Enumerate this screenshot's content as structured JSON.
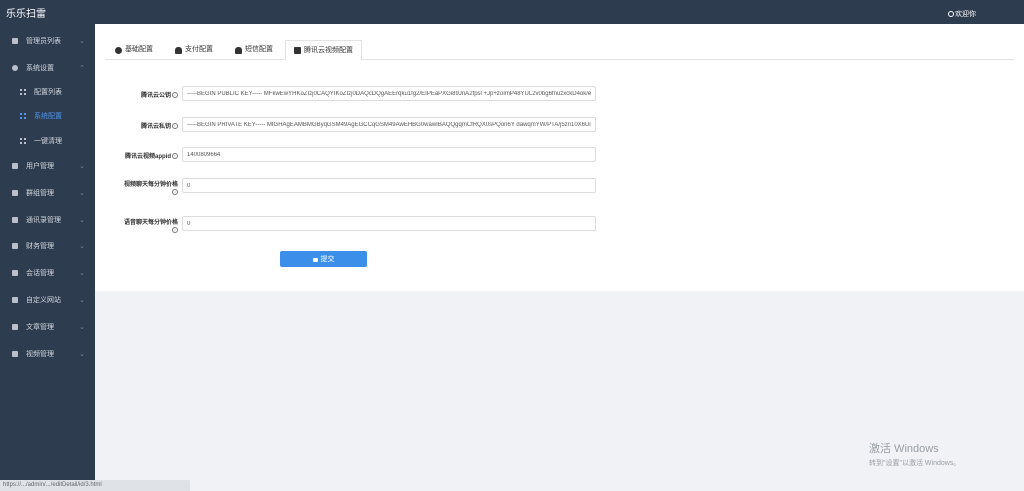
{
  "app": {
    "title": "乐乐扫雷",
    "welcome": "欢迎你"
  },
  "sidebar": {
    "items": [
      {
        "label": "管理员列表",
        "icon": "user-icon"
      },
      {
        "label": "系统设置",
        "icon": "gear-icon"
      },
      {
        "label": "配置列表",
        "icon": "grid-icon"
      },
      {
        "label": "系统配置",
        "icon": "grid-icon"
      },
      {
        "label": "一键清理",
        "icon": "grid-icon"
      },
      {
        "label": "用户管理",
        "icon": "user-icon"
      },
      {
        "label": "群组管理",
        "icon": "group-icon"
      },
      {
        "label": "通讯录管理",
        "icon": "user-icon"
      },
      {
        "label": "财务管理",
        "icon": "chart-icon"
      },
      {
        "label": "会话管理",
        "icon": "chat-icon"
      },
      {
        "label": "自定义网站",
        "icon": "monitor-icon"
      },
      {
        "label": "文章管理",
        "icon": "doc-icon"
      },
      {
        "label": "视频管理",
        "icon": "video-icon"
      }
    ]
  },
  "tabs": [
    {
      "label": "基础配置",
      "icon": "gear-icon"
    },
    {
      "label": "支付配置",
      "icon": "cloud-icon"
    },
    {
      "label": "短信配置",
      "icon": "cloud-icon"
    },
    {
      "label": "腾讯云视频配置",
      "icon": "cube-icon"
    }
  ],
  "form": {
    "public_key": {
      "label": "腾讯云公钥",
      "value": "-----BEGIN PUBLIC KEY----- MFkwEwYHKoZIzj0CAQYIKoZIzj0DAQcDQgAEErqku1fg2/EIPEaPXGi89JnA2fpsl +Jp+zoImP48YUL2v0bg6fnuzxckD4ok/e8"
    },
    "private_key": {
      "label": "腾讯云私钥",
      "value": "-----BEGIN PRIVATE KEY----- MIGHAgEAMBMGByqGSM49AgEGCCqGSM49AwEHBG0wawIBAQQgqmCfRQX0sPQon6Y dawqmYW/PTA/j5zn10X6Uik0"
    },
    "appid": {
      "label": "腾讯云视频appid",
      "value": "1400809664"
    },
    "video_price": {
      "label": "视频聊天每分钟价格",
      "value": "0"
    },
    "voice_price": {
      "label": "语音聊天每分钟价格",
      "value": "0"
    },
    "submit_label": "提交"
  },
  "statusbar": {
    "url": "https://.../admin/.../editDetail/id/3.html"
  },
  "activation": {
    "line1": "激活 Windows",
    "line2": "转到\"设置\"以激活 Windows。"
  }
}
